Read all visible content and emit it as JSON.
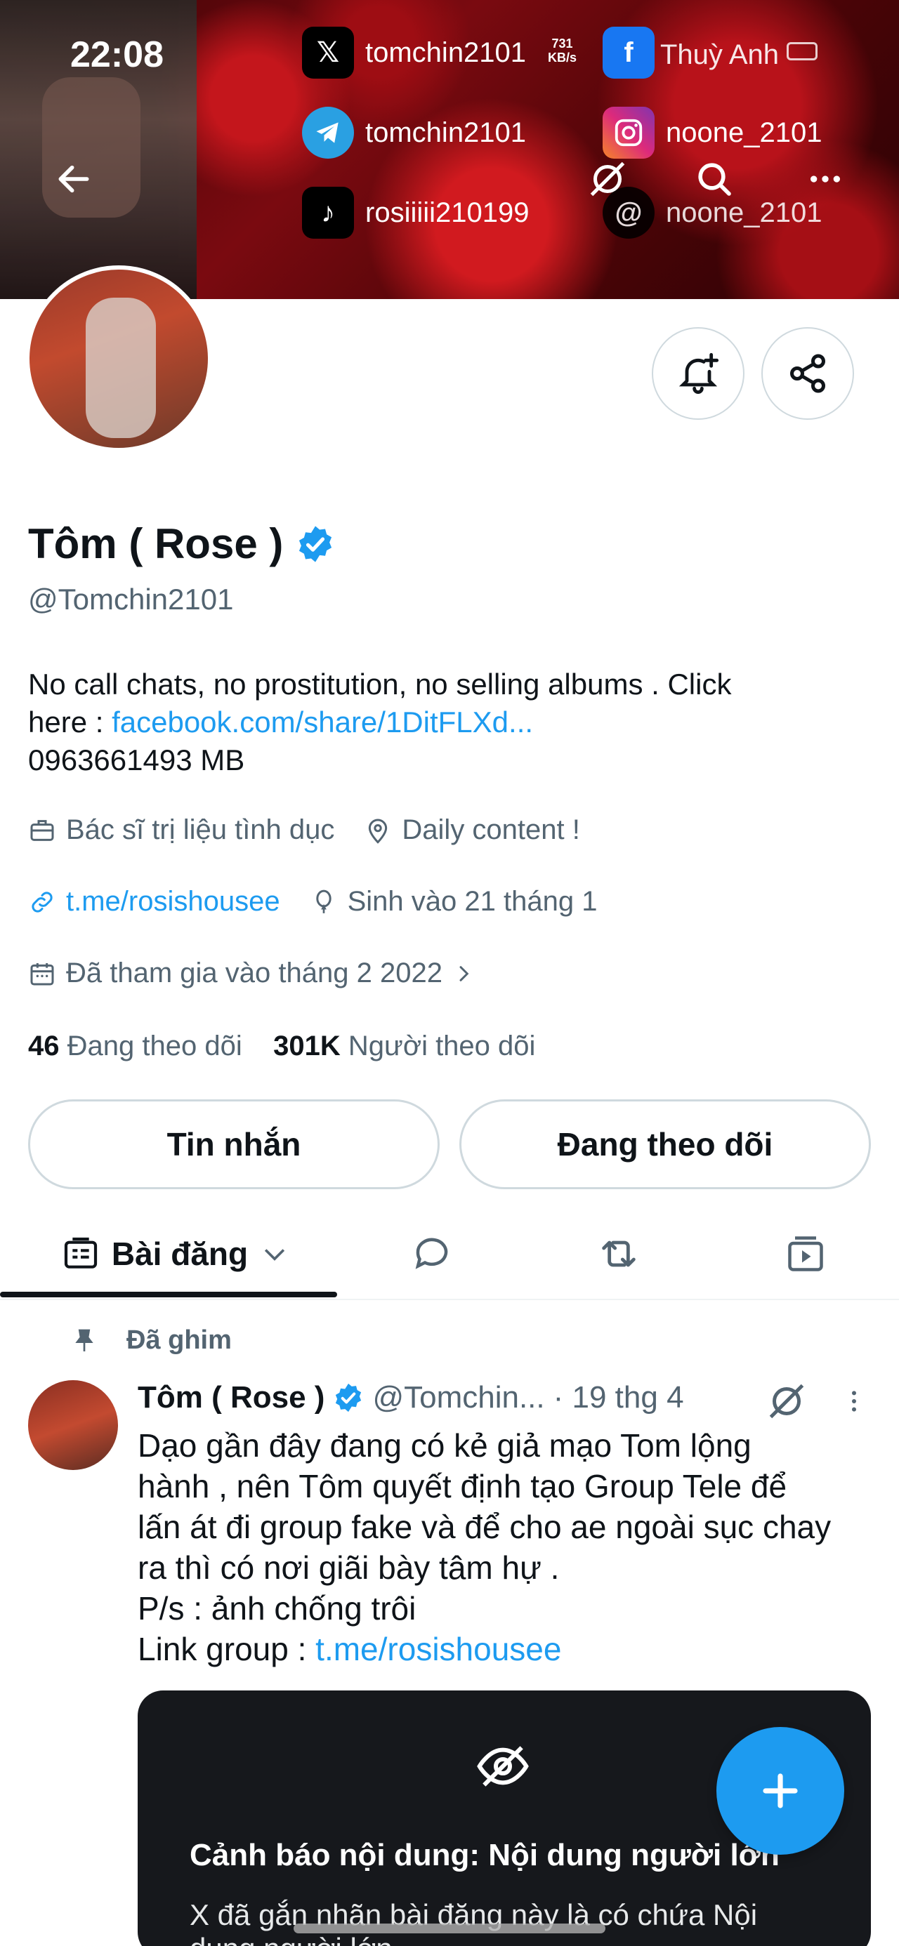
{
  "status": {
    "time": "22:08",
    "kbs": "731",
    "kbs_unit": "KB/s",
    "carrier": "Thuỳ Anh"
  },
  "socials": [
    {
      "platform": "x",
      "icon": "x-logo-icon",
      "handle": "tomchin2101"
    },
    {
      "platform": "telegram",
      "icon": "telegram-icon",
      "handle": "tomchin2101"
    },
    {
      "platform": "tiktok",
      "icon": "tiktok-icon",
      "handle": "rosiiiii210199"
    },
    {
      "platform": "facebook",
      "icon": "facebook-icon",
      "handle": ""
    },
    {
      "platform": "instagram",
      "icon": "instagram-icon",
      "handle": "noone_2101"
    },
    {
      "platform": "threads",
      "icon": "threads-icon",
      "handle": "noone_2101"
    }
  ],
  "profile": {
    "name": "Tôm ( Rose )",
    "handle": "@Tomchin2101",
    "bio_text": "No call chats, no prostitution, no selling albums . Click",
    "bio_here": "here : ",
    "bio_link": "facebook.com/share/1DitFLXd...",
    "bio_phone": "0963661493 MB",
    "job": "Bác sĩ trị liệu tình dục",
    "location": "Daily content !",
    "website": "t.me/rosishousee",
    "birthday": "Sinh vào 21 tháng 1",
    "joined": "Đã tham gia vào tháng 2 2022",
    "following_count": "46",
    "following_label": "Đang theo dõi",
    "followers_count": "301K",
    "followers_label": "Người theo dõi"
  },
  "actions": {
    "message": "Tin nhắn",
    "following": "Đang theo dõi"
  },
  "tabs": {
    "posts": "Bài đăng"
  },
  "post": {
    "pinned_label": "Đã ghim",
    "author": "Tôm ( Rose )",
    "handle": "@Tomchin...",
    "date": "· 19 thg 4",
    "lines": [
      "Dạo gần đây đang có kẻ giả mạo Tom lộng",
      "hành , nên Tôm quyết định tạo Group Tele để",
      "lấn át đi group fake và để cho ae ngoài sục chay",
      "ra thì có nơi giãi bày tâm hự .",
      "P/s : ảnh chống trôi"
    ],
    "link_prefix": "Link group : ",
    "link": "t.me/rosishousee",
    "warning_title": "Cảnh báo nội dung: Nội dung người lớn",
    "warning_body": "X đã gắn nhãn bài đăng này là có chứa Nội dung người lớn"
  },
  "colors": {
    "accent": "#1d9bf0",
    "text": "#0f1419",
    "muted": "#536471"
  }
}
